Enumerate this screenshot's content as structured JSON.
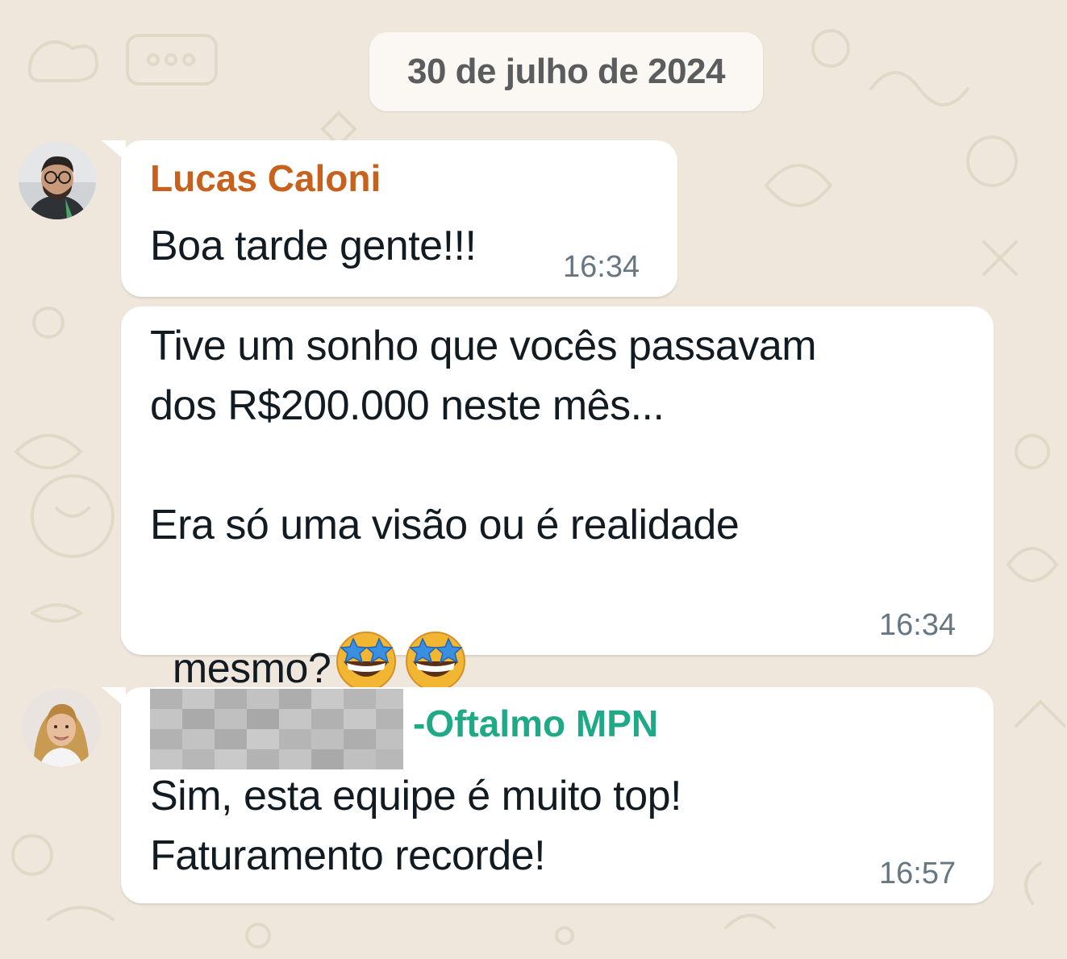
{
  "chat": {
    "date_separator": "30 de julho de 2024",
    "messages": [
      {
        "sender": "Lucas Caloni",
        "sender_color": "#c8611e",
        "text": "Boa tarde gente!!!",
        "time": "16:34",
        "avatar_icon": "man-with-glasses-avatar"
      },
      {
        "text_line1": "Tive um sonho que vocês passavam",
        "text_line2": "dos R$200.000 neste mês...",
        "text_line3": "Era só uma visão ou é realidade",
        "text_line4": "mesmo?",
        "emoji": "star-struck-emoji",
        "emoji_count": 2,
        "time": "16:34"
      },
      {
        "sender_suffix": "-Oftalmo MPN",
        "sender_color": "#1fa987",
        "sender_name_obscured": true,
        "text_line1": "Sim, esta equipe é muito top!",
        "text_line2": "Faturamento recorde!",
        "time": "16:57",
        "avatar_icon": "woman-smiling-avatar"
      }
    ]
  },
  "colors": {
    "wallpaper": "#efe7dc",
    "bubble": "#ffffff",
    "date_chip": "#fbf8f3",
    "message_text": "#111b21",
    "time_text": "#667781"
  }
}
